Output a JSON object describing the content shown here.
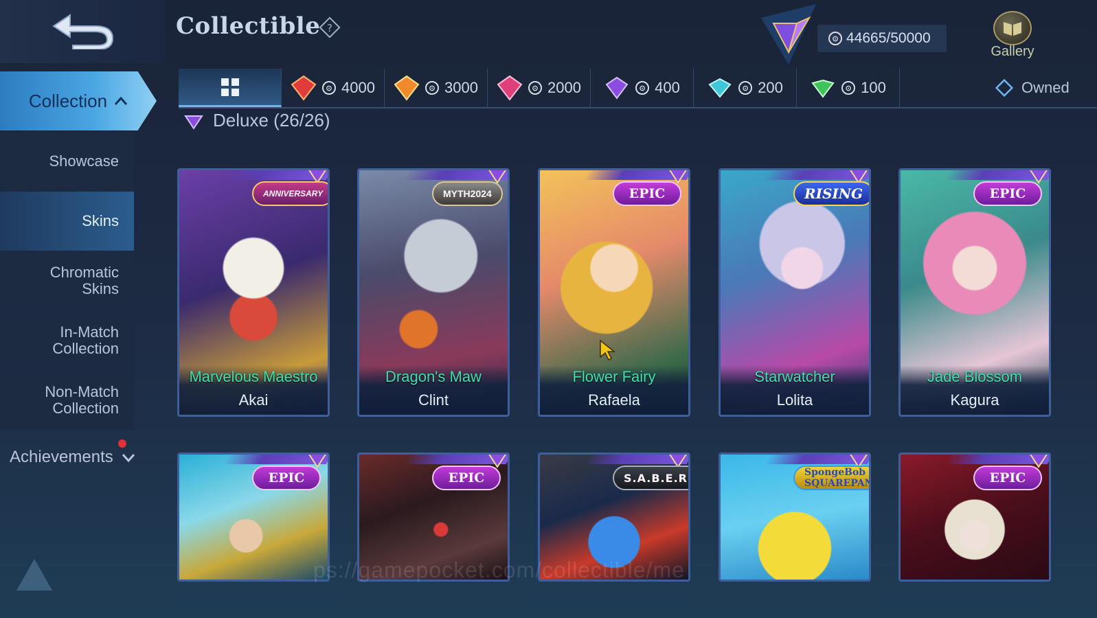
{
  "header": {
    "title": "Collectible",
    "points": "44665/50000",
    "gallery_label": "Gallery"
  },
  "tabs": [
    {
      "label": "",
      "icon": "grid-icon",
      "active": true
    },
    {
      "label": "4000",
      "icon": "red-gem-icon",
      "color": "#e23b3b"
    },
    {
      "label": "3000",
      "icon": "orange-gem-icon",
      "color": "#f08a2a"
    },
    {
      "label": "2000",
      "icon": "pink-gem-icon",
      "color": "#e0407a"
    },
    {
      "label": "400",
      "icon": "purple-gem-icon",
      "color": "#8a4de0"
    },
    {
      "label": "200",
      "icon": "cyan-gem-icon",
      "color": "#3ec7d6"
    },
    {
      "label": "100",
      "icon": "green-gem-icon",
      "color": "#3ec25a"
    }
  ],
  "owned_filter": "Owned",
  "sidebar": {
    "collection": "Collection",
    "items": [
      {
        "label": "Showcase"
      },
      {
        "label": "Skins",
        "active": true
      },
      {
        "label_lines": [
          "Chromatic",
          "Skins"
        ]
      },
      {
        "label_lines": [
          "In-Match",
          "Collection"
        ]
      },
      {
        "label_lines": [
          "Non-Match",
          "Collection"
        ]
      }
    ],
    "achievements": "Achievements"
  },
  "section": {
    "label": "Deluxe (26/26)"
  },
  "cards": [
    {
      "skin": "Marvelous Maestro",
      "hero": "Akai",
      "badge": "ANNIVERSARY",
      "badge_type": "anniv"
    },
    {
      "skin": "Dragon's Maw",
      "hero": "Clint",
      "badge": "MYTH2024",
      "badge_type": "myth"
    },
    {
      "skin": "Flower Fairy",
      "hero": "Rafaela",
      "badge": "EPIC",
      "badge_type": "epic"
    },
    {
      "skin": "Starwatcher",
      "hero": "Lolita",
      "badge": "RISING",
      "badge_type": "rising"
    },
    {
      "skin": "Jade Blossom",
      "hero": "Kagura",
      "badge": "EPIC",
      "badge_type": "epic"
    },
    {
      "badge": "EPIC",
      "badge_type": "epic"
    },
    {
      "badge": "EPIC",
      "badge_type": "epic"
    },
    {
      "badge": "S.A.B.E.R.",
      "badge_type": "saber"
    },
    {
      "badge": "SpongeBob SQUAREPANTS",
      "badge_type": "sponge"
    },
    {
      "badge": "EPIC",
      "badge_type": "epic"
    }
  ],
  "watermark": "ps://gamepocket.com/collectible/me"
}
